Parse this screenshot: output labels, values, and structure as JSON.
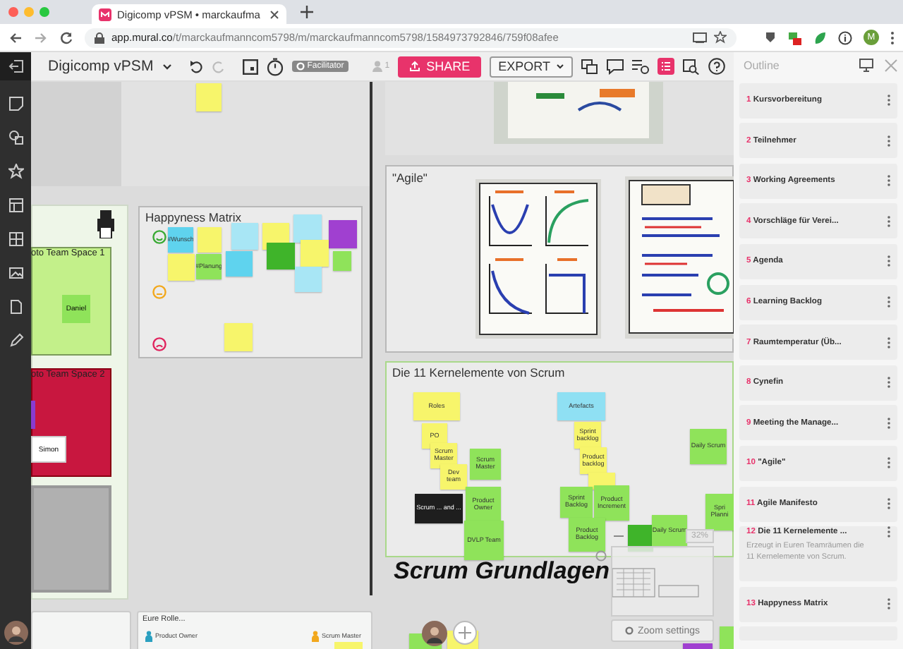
{
  "browser": {
    "tab_title": "Digicomp vPSM • marckaufma",
    "url_host": "app.mural.co",
    "url_path": "/t/marckaufmanncom5798/m/marckaufmanncom5798/1584973792846/759f08afee",
    "profile": "M"
  },
  "toolbar": {
    "board_title": "Digicomp vPSM",
    "facilitator": "Facilitator",
    "participants": "1",
    "share": "SHARE",
    "export": "EXPORT"
  },
  "canvas": {
    "top_note": {
      "color": "#f7f56b"
    },
    "team_spaces": [
      {
        "title": "oto Team Space 1",
        "member": "Daniel"
      },
      {
        "title": "oto Team Space 2",
        "member": "Simon"
      }
    ],
    "happyness": {
      "title": "Happyness Matrix",
      "notes": [
        {
          "text": "#Wunsch",
          "color": "#5fd3ee"
        },
        {
          "color": "#f7f56b"
        },
        {
          "color": "#a8e6f5"
        },
        {
          "color": "#f7f56b"
        },
        {
          "color": "#a8e6f5"
        },
        {
          "color": "#a040d0"
        },
        {
          "color": "#f7f56b"
        },
        {
          "text": "#Planung",
          "color": "#8fe35a"
        },
        {
          "color": "#5fd3ee"
        },
        {
          "color": "#3fb42a"
        },
        {
          "color": "#f7f56b"
        },
        {
          "color": "#8fe35a"
        },
        {
          "color": "#a8e6f5"
        },
        {
          "color": "#f7f56b"
        }
      ]
    },
    "agile": {
      "title": "\"Agile\""
    },
    "kernel": {
      "title": "Die 11 Kernelemente von Scrum",
      "notes": [
        {
          "text": "Roles",
          "color": "#f7f56b"
        },
        {
          "text": "PO",
          "color": "#f7f56b"
        },
        {
          "text": "Scrum Master",
          "color": "#f7f56b"
        },
        {
          "text": "Dev team",
          "color": "#f7f56b"
        },
        {
          "text": "Scrum Master",
          "color": "#8fe35a"
        },
        {
          "text": "Product Owner",
          "color": "#8fe35a"
        },
        {
          "text": "DVLP Team",
          "color": "#8fe35a"
        },
        {
          "text": "Scrum ... and ...",
          "color": "#1e1e1e"
        },
        {
          "text": "Artefacts",
          "color": "#8fe0f3"
        },
        {
          "text": "Sprint backlog",
          "color": "#f7f56b"
        },
        {
          "text": "Product backlog",
          "color": "#f7f56b"
        },
        {
          "color": "#f7f56b"
        },
        {
          "text": "Sprint Backlog",
          "color": "#8fe35a"
        },
        {
          "text": "Product Increment",
          "color": "#8fe35a"
        },
        {
          "text": "Product Backlog",
          "color": "#8fe35a"
        },
        {
          "text": "Daily Scrum",
          "color": "#8fe35a"
        },
        {
          "text": "Spri Planni",
          "color": "#8fe35a"
        },
        {
          "color": "#3fb42a"
        },
        {
          "text": "Daily Scrum",
          "color": "#8fe35a"
        }
      ]
    },
    "heading": "Scrum Grundlagen",
    "roles_panel": {
      "title": "Eure Rolle...",
      "roles": [
        {
          "name": "Product Owner",
          "color": "#2aa0c0"
        },
        {
          "name": "Scrum Master",
          "color": "#f2a81d"
        }
      ]
    },
    "bottom_notes": [
      {
        "color": "#8fe35a"
      },
      {
        "color": "#f7f56b"
      },
      {
        "color": "#a040d0"
      },
      {
        "color": "#8fe35a"
      }
    ],
    "zoom": {
      "level_text": "32%",
      "settings": "Zoom settings"
    }
  },
  "outline": {
    "title": "Outline",
    "items": [
      {
        "number": "1",
        "title": "Kursvorbereitung"
      },
      {
        "number": "2",
        "title": "Teilnehmer"
      },
      {
        "number": "3",
        "title": "Working Agreements"
      },
      {
        "number": "4",
        "title": "Vorschläge für Verei..."
      },
      {
        "number": "5",
        "title": "Agenda"
      },
      {
        "number": "6",
        "title": "Learning Backlog"
      },
      {
        "number": "7",
        "title": "Raumtemperatur (Üb..."
      },
      {
        "number": "8",
        "title": "Cynefin"
      },
      {
        "number": "9",
        "title": "Meeting the Manage..."
      },
      {
        "number": "10",
        "title": "\"Agile\""
      },
      {
        "number": "11",
        "title": "Agile Manifesto"
      },
      {
        "number": "12",
        "title": "Die 11 Kernelemente ...",
        "description": "Erzeugt in Euren Teamräumen die 11 Kernelemente von Scrum."
      },
      {
        "number": "13",
        "title": "Happyness Matrix"
      }
    ]
  }
}
